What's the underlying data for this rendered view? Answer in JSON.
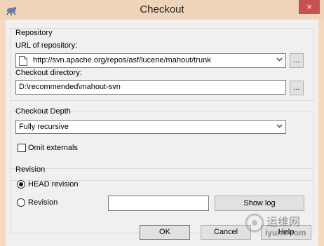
{
  "window": {
    "title": "Checkout",
    "close_label": "×"
  },
  "repository": {
    "group_label": "Repository",
    "url_label": "URL of repository:",
    "url_value": "http://svn.apache.org/repos/asf/lucene/mahout/trunk",
    "browse_label": "...",
    "dir_label": "Checkout directory:",
    "dir_value": "D:\\recommended\\mahout-svn",
    "dir_browse_label": "..."
  },
  "depth": {
    "group_label": "Checkout Depth",
    "selected": "Fully recursive",
    "omit_label": "Omit externals"
  },
  "revision": {
    "group_label": "Revision",
    "head_label": "HEAD revision",
    "revision_label": "Revision",
    "revision_value": "",
    "showlog_label": "Show log"
  },
  "buttons": {
    "ok": "OK",
    "cancel": "Cancel",
    "help": "Help"
  },
  "watermark": {
    "line1": "运维网",
    "line2": "iyunv.com"
  }
}
